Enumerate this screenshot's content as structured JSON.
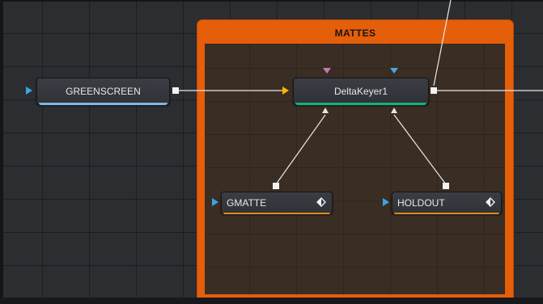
{
  "underlay": {
    "title": "MATTES"
  },
  "nodes": {
    "greenscreen": {
      "label": "GREENSCREEN"
    },
    "deltakeyer": {
      "label": "DeltaKeyer1"
    },
    "gmatte": {
      "label": "GMATTE",
      "icon": "diamond-view-icon"
    },
    "holdout": {
      "label": "HOLDOUT",
      "icon": "diamond-view-icon"
    }
  },
  "colors": {
    "background_input": "#3aa6e0",
    "foreground_input": "#f5b800",
    "effect_mask_input": "#c877b3",
    "garbage_matte_input": "#4aa5d9",
    "underlay": "#e55e0a",
    "mask_bar": "#e08c1c",
    "keyer_bar": "#14b27a",
    "loader_bar": "#7fb7e6"
  }
}
